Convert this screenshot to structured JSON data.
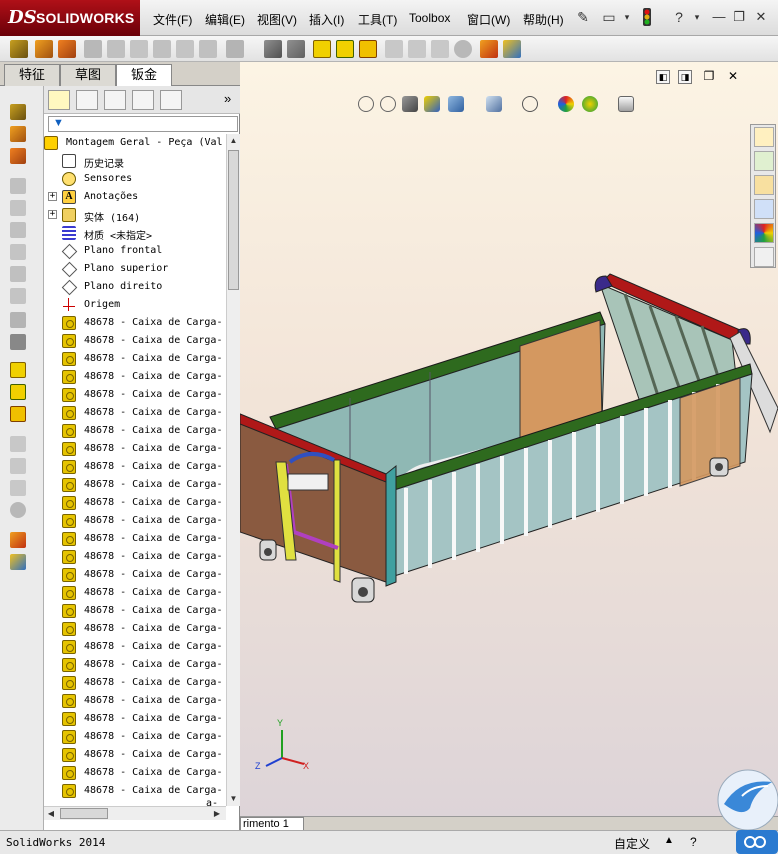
{
  "app": {
    "logo_mark": "DS",
    "logo_text": "SOLIDWORKS",
    "menus": [
      "文件(F)",
      "编辑(E)",
      "视图(V)",
      "插入(I)",
      "工具(T)",
      "Toolbox",
      "窗口(W)",
      "帮助(H)"
    ],
    "help_glyph": "?"
  },
  "tabs": [
    "特征",
    "草图",
    "钣金"
  ],
  "active_tab": "钣金",
  "tree": {
    "root": "Montagem Geral - Peça  (Val",
    "items": [
      {
        "icon": "history",
        "label": "历史记录",
        "expand": ""
      },
      {
        "icon": "sensor",
        "label": "Sensores",
        "expand": ""
      },
      {
        "icon": "annot",
        "label": "Anotações",
        "expand": "+"
      },
      {
        "icon": "solid",
        "label": "实体 (164)",
        "expand": "+"
      },
      {
        "icon": "material",
        "label": "材质 <未指定>",
        "expand": ""
      },
      {
        "icon": "plane",
        "label": "Plano frontal",
        "expand": ""
      },
      {
        "icon": "plane",
        "label": "Plano superior",
        "expand": ""
      },
      {
        "icon": "plane",
        "label": "Plano direito",
        "expand": ""
      },
      {
        "icon": "origin",
        "label": "Origem",
        "expand": ""
      }
    ],
    "part_label": "48678 - Caixa de Carga-",
    "part_count": 27,
    "partial_tail": "a-"
  },
  "viewport": {
    "triad_axes": [
      "Y",
      "Z",
      "X"
    ]
  },
  "doc_tab": "rimento 1",
  "status": {
    "left": "SolidWorks 2014",
    "right": "自定义",
    "arrow": "▲"
  },
  "colors": {
    "logo_red": "#a00010",
    "panel_bg": "#d4d0c8",
    "part_icon": "#e6c400"
  }
}
